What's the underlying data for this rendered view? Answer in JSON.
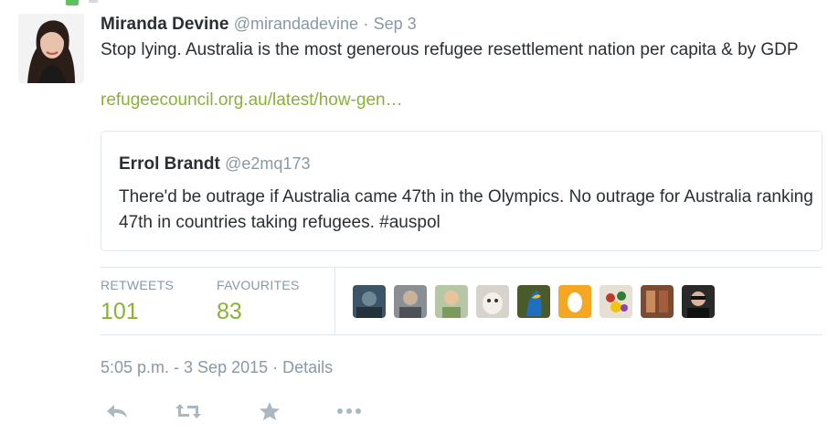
{
  "tweet": {
    "author_name": "Miranda Devine",
    "author_handle": "@mirandadevine",
    "separator": "·",
    "date": "Sep 3",
    "text": "Stop lying. Australia is the most generous refugee resettlement nation per capita & by GDP",
    "link": "refugeecouncil.org.au/latest/how-gen…"
  },
  "quoted_tweet": {
    "author_name": "Errol Brandt",
    "author_handle": "@e2mq173",
    "text": "There'd be outrage if Australia came 47th in the Olympics. No outrage for Australia ranking 47th in countries taking refugees. #auspol"
  },
  "stats": {
    "retweets_label": "RETWEETS",
    "retweets_count": "101",
    "favourites_label": "FAVOURITES",
    "favourites_count": "83"
  },
  "timestamp": {
    "time_date": "5:05 p.m. - 3 Sep 2015",
    "separator": "·",
    "details_link": "Details"
  },
  "actions": [
    "reply-icon",
    "retweet-icon",
    "favourite-icon",
    "more-icon"
  ],
  "colors": {
    "link_green": "#8ab03a",
    "text_dark": "#292f33",
    "text_muted": "#8899a6",
    "border": "#e1e8ed",
    "icon_gray": "#aab8c2"
  }
}
